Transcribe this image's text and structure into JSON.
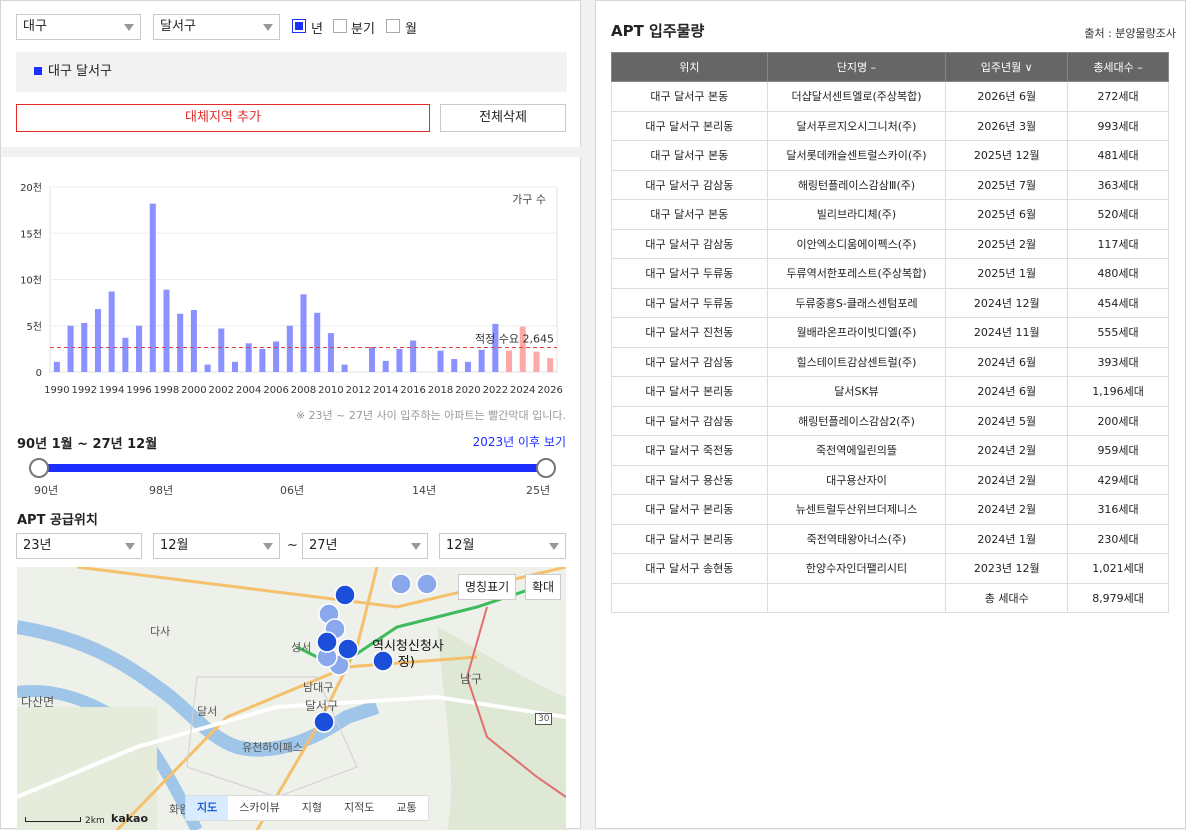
{
  "filters": {
    "city": "대구",
    "district": "달서구",
    "period_options": [
      {
        "label": "년",
        "checked": true
      },
      {
        "label": "분기",
        "checked": false
      },
      {
        "label": "월",
        "checked": false
      }
    ]
  },
  "region_box": {
    "label": "대구 달서구"
  },
  "buttons": {
    "add_region": "대체지역 추가",
    "delete_all": "전체삭제"
  },
  "chart_data": {
    "type": "bar",
    "legend_label": "가구 수",
    "y_ticks": [
      "0",
      "5천",
      "10천",
      "15천",
      "20천"
    ],
    "ylim": [
      0,
      20000
    ],
    "x_tick_labels": [
      "1990",
      "1992",
      "1994",
      "1996",
      "1998",
      "2000",
      "2002",
      "2004",
      "2006",
      "2008",
      "2010",
      "2012",
      "2014",
      "2016",
      "2018",
      "2020",
      "2022",
      "2024",
      "2026"
    ],
    "years": [
      1990,
      1991,
      1992,
      1993,
      1994,
      1995,
      1996,
      1997,
      1998,
      1999,
      2000,
      2001,
      2002,
      2003,
      2004,
      2005,
      2006,
      2007,
      2008,
      2009,
      2010,
      2011,
      2012,
      2013,
      2014,
      2015,
      2016,
      2017,
      2018,
      2019,
      2020,
      2021,
      2022,
      2023,
      2024,
      2025,
      2026
    ],
    "values": [
      1100,
      5000,
      5300,
      6800,
      8700,
      3700,
      5000,
      18200,
      8900,
      6300,
      6700,
      800,
      4700,
      1100,
      3100,
      2500,
      3300,
      5000,
      8400,
      6400,
      4200,
      800,
      0,
      2700,
      1200,
      2500,
      3400,
      0,
      2300,
      1400,
      1100,
      2400,
      5200,
      2300,
      4900,
      2200,
      1500
    ],
    "highlight_from_year": 2023,
    "reference_line": {
      "label": "적정 수요 2,645",
      "value": 2645
    },
    "bar_color": "#8b91ff",
    "highlight_color": "#ffa8a8",
    "ref_color": "#e04040"
  },
  "note": "※ 23년 ~ 27년 사이 입주하는 아파트는 빨간막대 입니다.",
  "range": {
    "label": "90년 1월 ~ 27년 12월",
    "after_link": "2023년 이후 보기",
    "ticks": [
      "90년",
      "98년",
      "06년",
      "14년",
      "25년"
    ]
  },
  "supply": {
    "title": "APT 공급위치",
    "from_year": "23년",
    "from_month": "12월",
    "tilde": "~",
    "to_year": "27년",
    "to_month": "12월"
  },
  "map": {
    "name_toggle": "명칭표기",
    "zoom": "확대",
    "types": [
      {
        "label": "지도",
        "active": true
      },
      {
        "label": "스카이뷰",
        "active": false
      },
      {
        "label": "지형",
        "active": false
      },
      {
        "label": "지적도",
        "active": false
      },
      {
        "label": "교통",
        "active": false
      }
    ],
    "scale": "2km",
    "logo": "kakao",
    "labels": {
      "city_hall_1": "역시청신청사",
      "city_hall_2": "(30 정)",
      "namgu": "남구",
      "dalseogu": "달서구",
      "dasa": "다사",
      "dasan": "다산면",
      "seongseo": "성서",
      "dalseo_ic": "달서",
      "daedaegu": "남대구",
      "yucheon": "유천하이패스",
      "hwawon": "화원",
      "route30": "30"
    }
  },
  "apt": {
    "title": "APT 입주물량",
    "source": "출처 : 분양물량조사",
    "headers": [
      "위치",
      "단지명 –",
      "입주년월 ∨",
      "총세대수 –"
    ],
    "rows": [
      [
        "대구 달서구 본동",
        "더샵달서센트엘로(주상복합)",
        "2026년 6월",
        "272세대"
      ],
      [
        "대구 달서구 본리동",
        "달서푸르지오시그니처(주)",
        "2026년 3월",
        "993세대"
      ],
      [
        "대구 달서구 본동",
        "달서롯데캐슬센트럴스카이(주)",
        "2025년 12월",
        "481세대"
      ],
      [
        "대구 달서구 감삼동",
        "해링턴플레이스감삼Ⅲ(주)",
        "2025년 7월",
        "363세대"
      ],
      [
        "대구 달서구 본동",
        "빌리브라디체(주)",
        "2025년 6월",
        "520세대"
      ],
      [
        "대구 달서구 감삼동",
        "이안엑소디움에이펙스(주)",
        "2025년 2월",
        "117세대"
      ],
      [
        "대구 달서구 두류동",
        "두류역서한포레스트(주상복합)",
        "2025년 1월",
        "480세대"
      ],
      [
        "대구 달서구 두류동",
        "두류중흥S-클래스센텀포레",
        "2024년 12월",
        "454세대"
      ],
      [
        "대구 달서구 진천동",
        "월배라온프라이빗디엘(주)",
        "2024년 11월",
        "555세대"
      ],
      [
        "대구 달서구 감삼동",
        "힐스테이트감삼센트럴(주)",
        "2024년 6월",
        "393세대"
      ],
      [
        "대구 달서구 본리동",
        "달서SK뷰",
        "2024년 6월",
        "1,196세대"
      ],
      [
        "대구 달서구 감삼동",
        "해링턴플레이스감삼2(주)",
        "2024년 5월",
        "200세대"
      ],
      [
        "대구 달서구 죽전동",
        "죽전역에일린의뜰",
        "2024년 2월",
        "959세대"
      ],
      [
        "대구 달서구 용산동",
        "대구용산자이",
        "2024년 2월",
        "429세대"
      ],
      [
        "대구 달서구 본리동",
        "뉴센트럴두산위브더제니스",
        "2024년 2월",
        "316세대"
      ],
      [
        "대구 달서구 본리동",
        "죽전역태왕아너스(주)",
        "2024년 1월",
        "230세대"
      ],
      [
        "대구 달서구 송현동",
        "한양수자인더팰리시티",
        "2023년 12월",
        "1,021세대"
      ]
    ],
    "total_label": "총 세대수",
    "total_value": "8,979세대"
  }
}
